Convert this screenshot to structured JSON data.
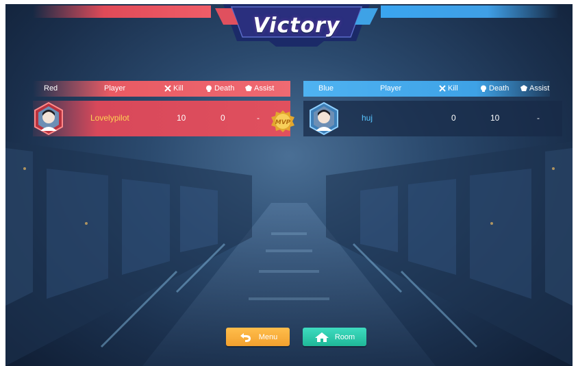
{
  "title": "Victory",
  "teams": {
    "red": {
      "label": "Red",
      "columns": {
        "player": "Player",
        "kill": "Kill",
        "death": "Death",
        "assist": "Assist"
      },
      "rows": [
        {
          "name": "Lovelypilot",
          "kill": "10",
          "death": "0",
          "assist": "-",
          "badge": "MVP"
        }
      ]
    },
    "blue": {
      "label": "Blue",
      "columns": {
        "player": "Player",
        "kill": "Kill",
        "death": "Death",
        "assist": "Assist"
      },
      "rows": [
        {
          "name": "huj",
          "kill": "0",
          "death": "10",
          "assist": "-"
        }
      ]
    }
  },
  "buttons": {
    "menu": "Menu",
    "room": "Room"
  },
  "icons": {
    "kill": "crossed-swords-icon",
    "death": "skull-icon",
    "assist": "shield-icon",
    "menu": "back-arrow-icon",
    "room": "home-icon"
  },
  "colors": {
    "red_team": "#e04a58",
    "blue_team": "#3ea2e6",
    "red_name": "#ffd454",
    "blue_name": "#58c5ff",
    "menu_button": "#f2a02e",
    "room_button": "#1fb898"
  }
}
